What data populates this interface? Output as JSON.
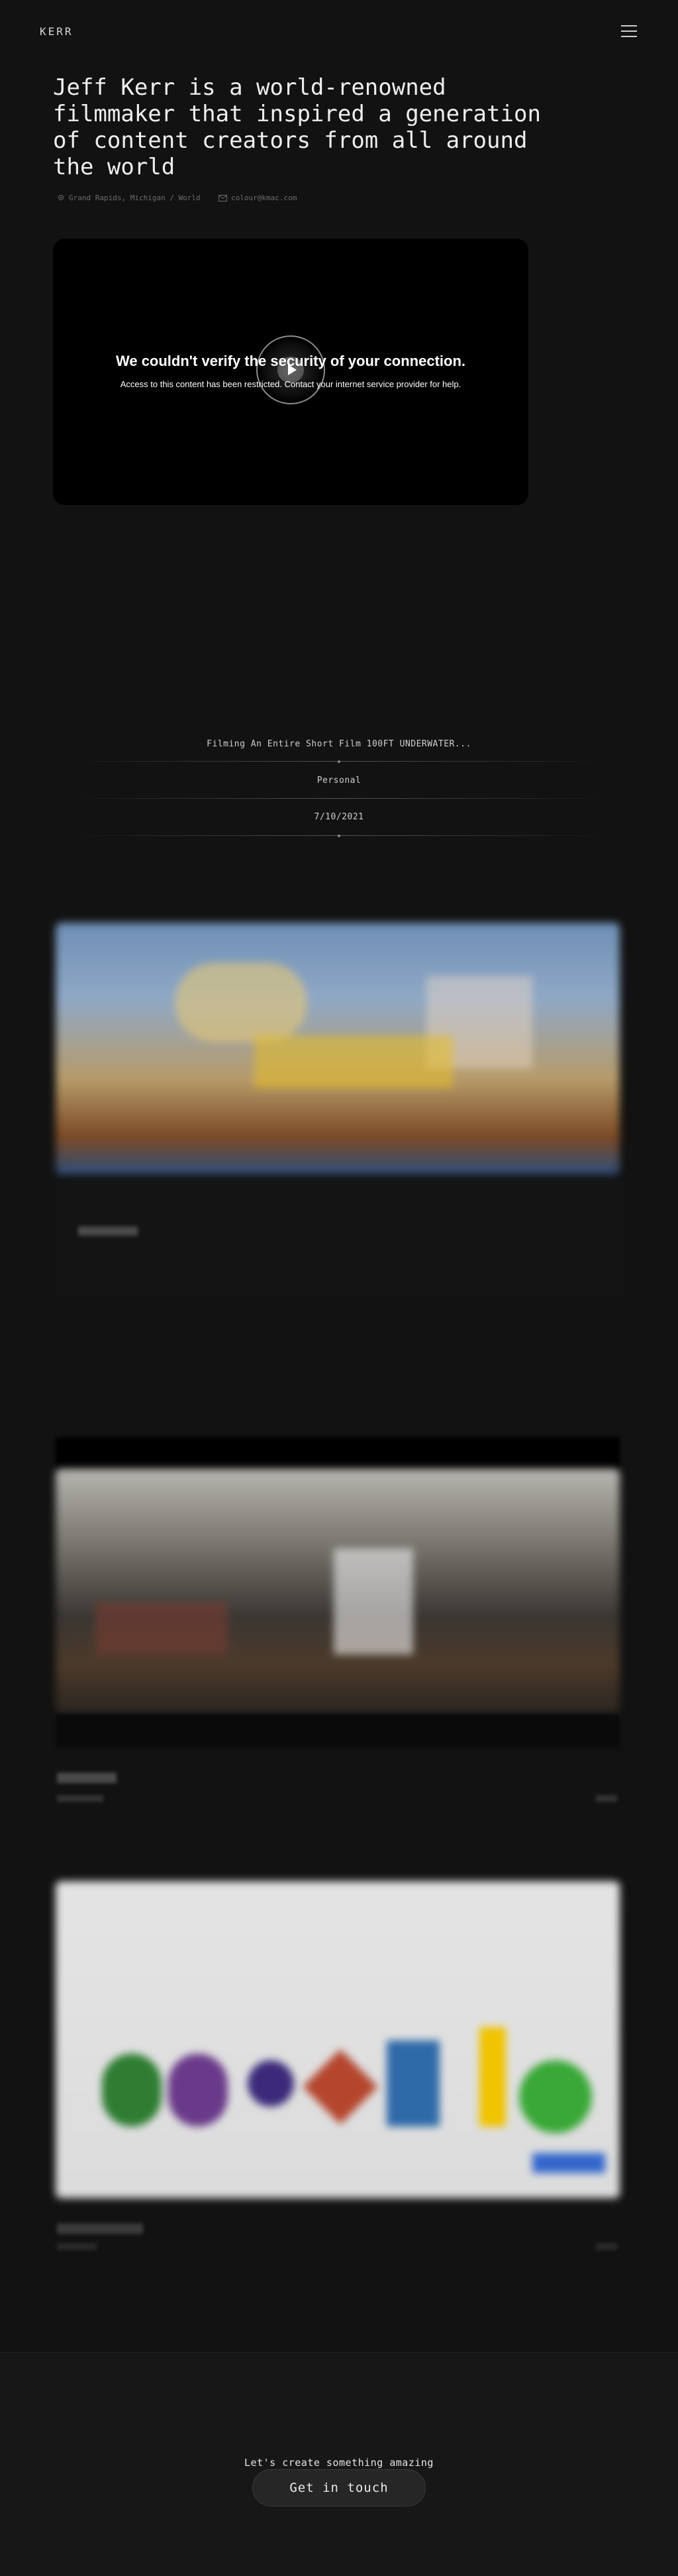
{
  "header": {
    "logo": "KERR",
    "menu_icon": "hamburger-icon"
  },
  "hero": {
    "title": "Jeff Kerr is a world-renowned filmmaker that inspired a generation of content creators from all around the world",
    "location": "Grand Rapids, Michigan / World",
    "email": "colour@kmac.com",
    "location_icon": "location-pin-icon",
    "email_icon": "mail-icon"
  },
  "video": {
    "heading": "We couldn't verify the security of your connection.",
    "message": "Access to this content has been restricted. Contact your internet service provider for help.",
    "play_icon": "play-icon"
  },
  "details": {
    "title": "Filming An Entire Short Film 100FT UNDERWATER...",
    "category": "Personal",
    "date": "7/10/2021"
  },
  "footer": {
    "cta_label": "Let's create something amazing",
    "cta_button": "Get in touch"
  },
  "colors": {
    "background": "#121212",
    "footer": "#171717",
    "text": "#e6e6e6",
    "muted": "#6d6d6d"
  }
}
